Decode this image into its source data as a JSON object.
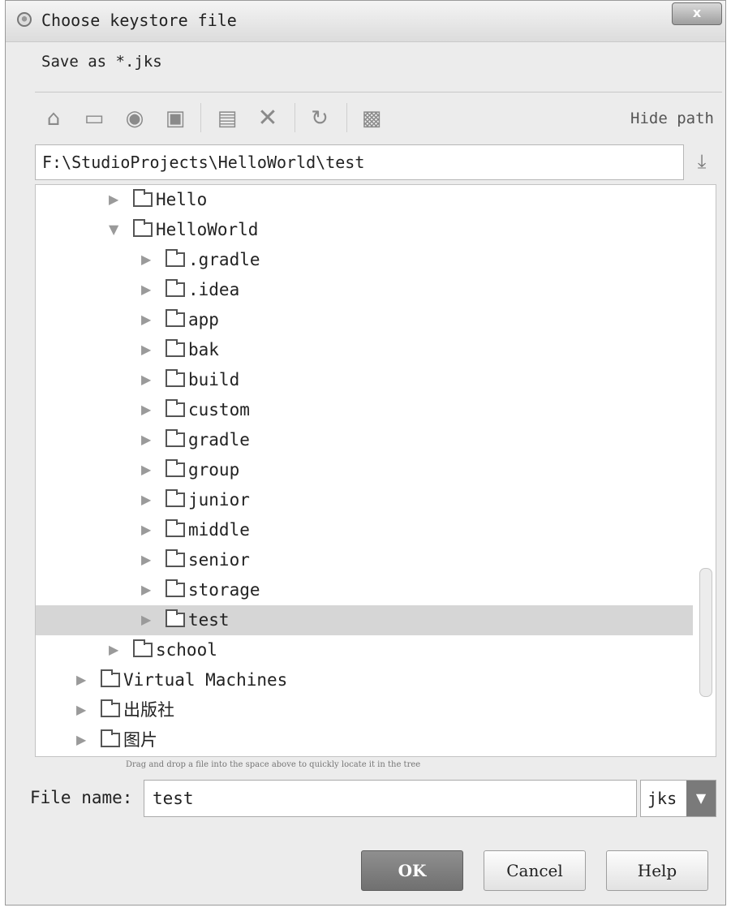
{
  "window": {
    "title": "Choose keystore file",
    "close_label": "x",
    "description": "Save as *.jks"
  },
  "toolbar": {
    "icons": [
      "home-icon",
      "desktop-icon",
      "project-icon",
      "module-icon",
      "new-folder-icon",
      "delete-icon",
      "refresh-icon",
      "show-hidden-icon"
    ],
    "hide_path_label": "Hide path"
  },
  "path": {
    "value": "F:\\StudioProjects\\HelloWorld\\test"
  },
  "tree": {
    "items": [
      {
        "label": "Hello",
        "depth": 1,
        "expanded": false,
        "selected": false
      },
      {
        "label": "HelloWorld",
        "depth": 1,
        "expanded": true,
        "selected": false
      },
      {
        "label": ".gradle",
        "depth": 2,
        "expanded": false,
        "selected": false
      },
      {
        "label": ".idea",
        "depth": 2,
        "expanded": false,
        "selected": false
      },
      {
        "label": "app",
        "depth": 2,
        "expanded": false,
        "selected": false
      },
      {
        "label": "bak",
        "depth": 2,
        "expanded": false,
        "selected": false
      },
      {
        "label": "build",
        "depth": 2,
        "expanded": false,
        "selected": false
      },
      {
        "label": "custom",
        "depth": 2,
        "expanded": false,
        "selected": false
      },
      {
        "label": "gradle",
        "depth": 2,
        "expanded": false,
        "selected": false
      },
      {
        "label": "group",
        "depth": 2,
        "expanded": false,
        "selected": false
      },
      {
        "label": "junior",
        "depth": 2,
        "expanded": false,
        "selected": false
      },
      {
        "label": "middle",
        "depth": 2,
        "expanded": false,
        "selected": false
      },
      {
        "label": "senior",
        "depth": 2,
        "expanded": false,
        "selected": false
      },
      {
        "label": "storage",
        "depth": 2,
        "expanded": false,
        "selected": false
      },
      {
        "label": "test",
        "depth": 2,
        "expanded": false,
        "selected": true
      },
      {
        "label": "school",
        "depth": 1,
        "expanded": false,
        "selected": false
      },
      {
        "label": "Virtual Machines",
        "depth": 0,
        "expanded": false,
        "selected": false
      },
      {
        "label": "出版社",
        "depth": 0,
        "expanded": false,
        "selected": false
      },
      {
        "label": "图片",
        "depth": 0,
        "expanded": false,
        "selected": false
      }
    ],
    "drop_hint": "Drag and drop a file into the space above to quickly locate it in the tree"
  },
  "file_name": {
    "label": "File name:",
    "value": "test",
    "type_value": "jks"
  },
  "buttons": {
    "ok": "OK",
    "cancel": "Cancel",
    "help": "Help"
  }
}
